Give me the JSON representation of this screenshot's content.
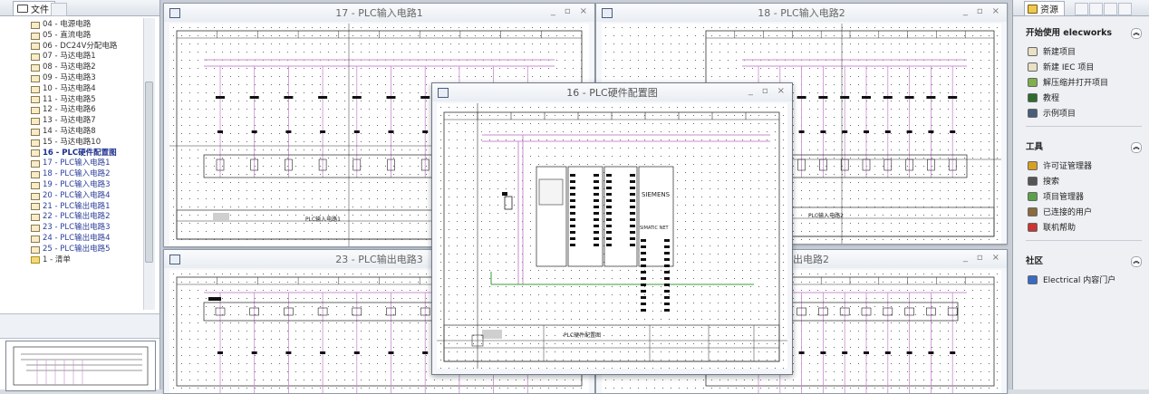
{
  "left_panel": {
    "tab_label": "文件",
    "tree_items": [
      {
        "label": "04 - 电源电路",
        "state": "normal"
      },
      {
        "label": "05 - 直流电路",
        "state": "normal"
      },
      {
        "label": "06 - DC24V分配电路",
        "state": "normal"
      },
      {
        "label": "07 - 马达电路1",
        "state": "normal"
      },
      {
        "label": "08 - 马达电路2",
        "state": "normal"
      },
      {
        "label": "09 - 马达电路3",
        "state": "normal"
      },
      {
        "label": "10 - 马达电路4",
        "state": "normal"
      },
      {
        "label": "11 - 马达电路5",
        "state": "normal"
      },
      {
        "label": "12 - 马达电路6",
        "state": "normal"
      },
      {
        "label": "13 - 马达电路7",
        "state": "normal"
      },
      {
        "label": "14 - 马达电路8",
        "state": "normal"
      },
      {
        "label": "15 - 马达电路10",
        "state": "normal"
      },
      {
        "label": "16 - PLC硬件配置图",
        "state": "active"
      },
      {
        "label": "17 - PLC输入电路1",
        "state": "blue"
      },
      {
        "label": "18 - PLC输入电路2",
        "state": "blue"
      },
      {
        "label": "19 - PLC输入电路3",
        "state": "blue"
      },
      {
        "label": "20 - PLC输入电路4",
        "state": "blue"
      },
      {
        "label": "21 - PLC输出电路1",
        "state": "blue"
      },
      {
        "label": "22 - PLC输出电路2",
        "state": "blue"
      },
      {
        "label": "23 - PLC输出电路3",
        "state": "blue"
      },
      {
        "label": "24 - PLC输出电路4",
        "state": "blue"
      },
      {
        "label": "25 - PLC输出电路5",
        "state": "blue"
      },
      {
        "label": "1 - 清单",
        "state": "folder"
      }
    ]
  },
  "windows": {
    "w17": {
      "title": "17 - PLC输入电路1",
      "sheet_title": "PLC输入电路1"
    },
    "w18": {
      "title": "18 - PLC输入电路2",
      "sheet_title": "PLC输入电路2"
    },
    "w23": {
      "title": "23 - PLC输出电路3"
    },
    "w22": {
      "title": "出电路2"
    },
    "w16": {
      "title": "16 - PLC硬件配置图",
      "sheet_title": "PLC硬件配置图",
      "plc_brand": "SIEMENS",
      "plc_model": "SIMATIC NET"
    }
  },
  "window_controls": {
    "minimize": "_",
    "restore": "▫",
    "close": "×"
  },
  "right_panel": {
    "tab_label": "资源",
    "sections": [
      {
        "title": "开始使用 elecworks",
        "items": [
          "新建项目",
          "新建 IEC 项目",
          "解压缩并打开项目",
          "教程",
          "示例项目"
        ]
      },
      {
        "title": "工具",
        "items": [
          "许可证管理器",
          "搜索",
          "项目管理器",
          "已连接的用户",
          "联机帮助"
        ]
      },
      {
        "title": "社区",
        "items": [
          "Electrical 内容门户"
        ]
      }
    ],
    "collapse_glyph": "︽"
  },
  "colors": {
    "accent": "#1d2f8c",
    "wire_pink": "#c88ccf",
    "wire_green": "#3b9b3b",
    "panel_bg": "#eef0f3"
  }
}
